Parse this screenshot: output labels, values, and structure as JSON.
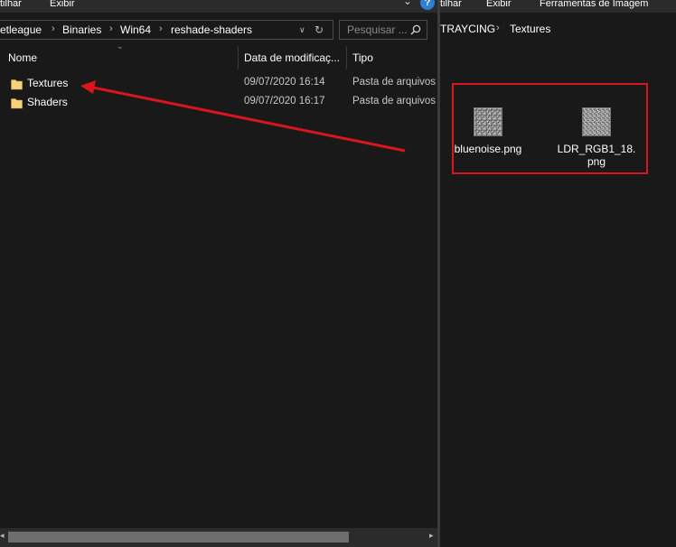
{
  "left_window": {
    "menu": [
      "tilhar",
      "Exibir"
    ],
    "breadcrumb": [
      "etleague",
      "Binaries",
      "Win64",
      "reshade-shaders"
    ],
    "search_placeholder": "Pesquisar ...",
    "columns": [
      "Nome",
      "Data de modificaç...",
      "Tipo"
    ],
    "rows": [
      {
        "name": "Textures",
        "date": "09/07/2020 16:14",
        "type": "Pasta de arquivos"
      },
      {
        "name": "Shaders",
        "date": "09/07/2020 16:17",
        "type": "Pasta de arquivos"
      }
    ]
  },
  "right_window": {
    "menu": [
      "tilhar",
      "Exibir",
      "Ferramentas de Imagem"
    ],
    "breadcrumb": [
      "TRAYCING",
      "Textures"
    ],
    "help_glyph": "?",
    "files": [
      {
        "name": "bluenoise.png"
      },
      {
        "name": "LDR_RGB1_18.png"
      }
    ]
  },
  "colors": {
    "background": "#191919",
    "annotation": "#d8161b",
    "folder": "#f3d27a",
    "help": "#2f7fd3"
  },
  "icons": [
    "folder-icon",
    "search-icon",
    "refresh-icon",
    "chevron-down-icon",
    "help-icon",
    "noise-thumbnail"
  ]
}
